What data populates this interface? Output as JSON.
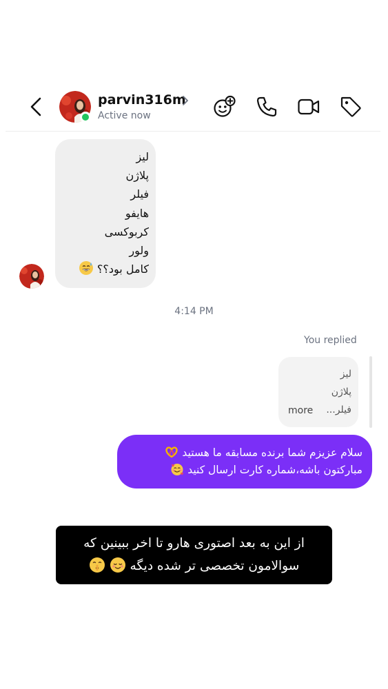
{
  "header": {
    "username": "parvin316m",
    "status": "Active now",
    "icons": [
      "back-arrow-icon",
      "chevron-right-icon",
      "effects-icon",
      "phone-icon",
      "video-camera-icon",
      "tag-icon"
    ]
  },
  "received_message": {
    "lines": [
      "لیز",
      "پلاژن",
      "فیلر",
      "هایفو",
      "کربوکسی",
      "ولور",
      "کامل بود؟؟"
    ],
    "emoji": "grinning-sweat-emoji"
  },
  "timestamp": "4:14 PM",
  "you_replied": "You replied",
  "quoted_reply": {
    "lines": [
      "لیز",
      "پلاژن"
    ],
    "preview": "فیلر...",
    "more": "more"
  },
  "sent_message": {
    "line1": "سلام عزیزم شما برنده مسابقه ما هستید",
    "line2": "مبارکتون باشه،شماره کارت ارسال کنید",
    "emojis": [
      "heart-hands-emoji",
      "smiling-hearts-emoji"
    ]
  },
  "caption": {
    "line1": "از این به بعد اصتوری هارو تا اخر ببینین که",
    "line2": "سوالامون تخصصی تر شده دیگه",
    "emojis": [
      "relieved-emoji",
      "shushing-emoji"
    ]
  },
  "colors": {
    "sent_bubble": "#7b2ff7",
    "received_bubble": "#efefef",
    "online_dot": "#22c55e",
    "caption_bg": "#000000"
  }
}
